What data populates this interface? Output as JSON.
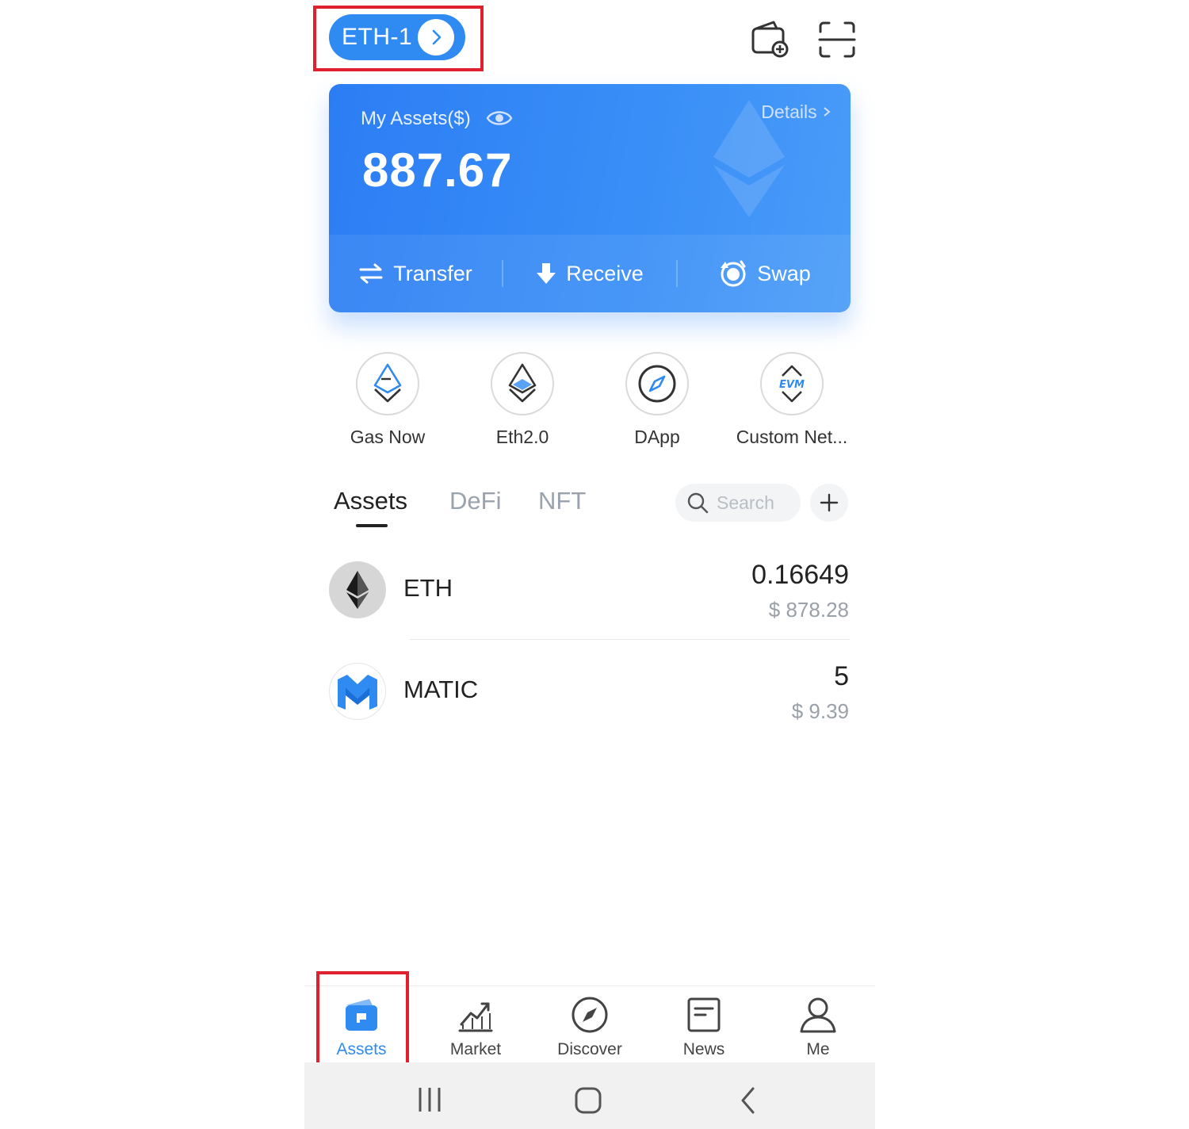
{
  "header": {
    "wallet_name": "ETH-1",
    "icons": [
      "wallet-add-icon",
      "scan-icon"
    ]
  },
  "card": {
    "label": "My Assets($)",
    "details_label": "Details",
    "total": "887.67",
    "actions": [
      {
        "label": "Transfer",
        "icon": "transfer-icon"
      },
      {
        "label": "Receive",
        "icon": "receive-icon"
      },
      {
        "label": "Swap",
        "icon": "swap-icon"
      }
    ]
  },
  "quick_actions": [
    {
      "label": "Gas Now",
      "icon": "gas-eth-icon"
    },
    {
      "label": "Eth2.0",
      "icon": "eth2-icon"
    },
    {
      "label": "DApp",
      "icon": "compass-icon"
    },
    {
      "label": "Custom Net...",
      "icon": "evm-icon"
    }
  ],
  "evm_text": "EVM",
  "tabs": [
    {
      "label": "Assets",
      "active": true
    },
    {
      "label": "DeFi",
      "active": false
    },
    {
      "label": "NFT",
      "active": false
    }
  ],
  "search": {
    "placeholder": "Search"
  },
  "assets": [
    {
      "symbol": "ETH",
      "amount": "0.16649",
      "value": "$ 878.28"
    },
    {
      "symbol": "MATIC",
      "amount": "5",
      "value": "$ 9.39"
    }
  ],
  "bottom_nav": [
    {
      "label": "Assets",
      "icon": "wallet-icon",
      "active": true
    },
    {
      "label": "Market",
      "icon": "chart-icon",
      "active": false
    },
    {
      "label": "Discover",
      "icon": "compass-icon",
      "active": false
    },
    {
      "label": "News",
      "icon": "news-icon",
      "active": false
    },
    {
      "label": "Me",
      "icon": "person-icon",
      "active": false
    }
  ],
  "colors": {
    "accent": "#2f8bf2",
    "highlight": "#e0202c"
  }
}
